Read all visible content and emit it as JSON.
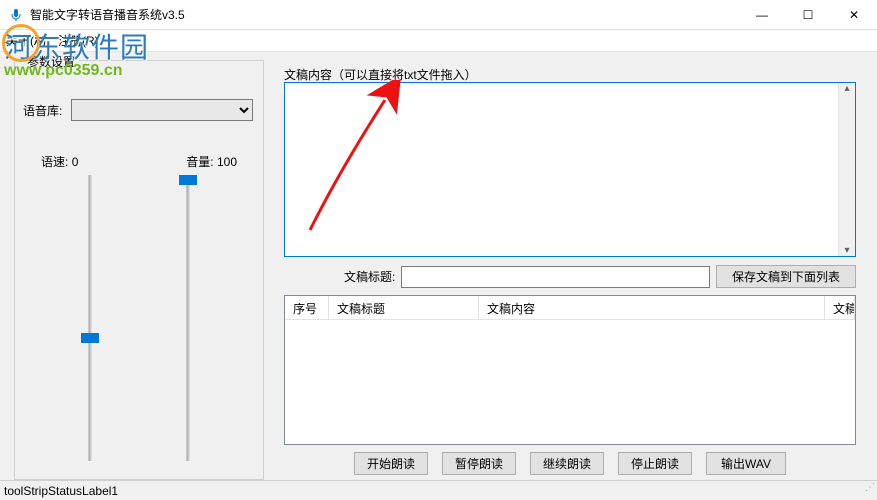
{
  "title": "智能文字转语音播音系统v3.5",
  "menus": {
    "about": "关于(A)",
    "register": "注册(R)"
  },
  "settings": {
    "group_title": "参数设置",
    "voice_library_label": "语音库:",
    "speed_label": "语速:",
    "speed_value": "0",
    "volume_label": "音量:",
    "volume_value": "100"
  },
  "content": {
    "label": "文稿内容（可以直接将txt文件拖入）",
    "value": ""
  },
  "doc_title": {
    "label": "文稿标题:",
    "value": "",
    "save_button": "保存文稿到下面列表"
  },
  "list": {
    "columns": {
      "seq": "序号",
      "title": "文稿标题",
      "content": "文稿内容",
      "last": "文稿"
    }
  },
  "buttons": {
    "start": "开始朗读",
    "pause": "暂停朗读",
    "resume": "继续朗读",
    "stop": "停止朗读",
    "export": "输出WAV"
  },
  "status": "toolStripStatusLabel1",
  "watermark": {
    "line1": "河东软件园",
    "line2": "www.pc0359.cn"
  },
  "window_controls": {
    "min": "—",
    "max": "☐",
    "close": "✕"
  }
}
